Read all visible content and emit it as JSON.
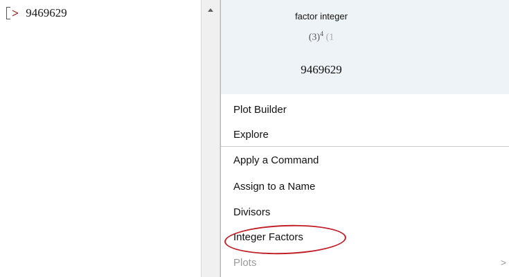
{
  "worksheet": {
    "prompt_symbol": ">",
    "input_value": "9469629"
  },
  "context_menu": {
    "preview": {
      "title": "factor integer",
      "formula_base": "(3)",
      "formula_exponent": "4",
      "formula_trailing": "(1",
      "result": "9469629"
    },
    "items": [
      {
        "label": "Plot Builder",
        "enabled": true
      },
      {
        "label": "Explore",
        "enabled": true
      },
      {
        "label": "Apply a Command",
        "enabled": true
      },
      {
        "label": "Assign to a Name",
        "enabled": true
      },
      {
        "label": "Divisors",
        "enabled": true
      },
      {
        "label": "Integer Factors",
        "enabled": true,
        "highlighted": true
      },
      {
        "label": "Plots",
        "enabled": false,
        "has_submenu": true
      }
    ],
    "submenu_arrow": ">"
  },
  "colors": {
    "prompt": "#8b1a1a",
    "preview_background": "#eef3f8",
    "highlight_annotation": "#c0202a",
    "disabled_text": "#9a9a9a"
  }
}
